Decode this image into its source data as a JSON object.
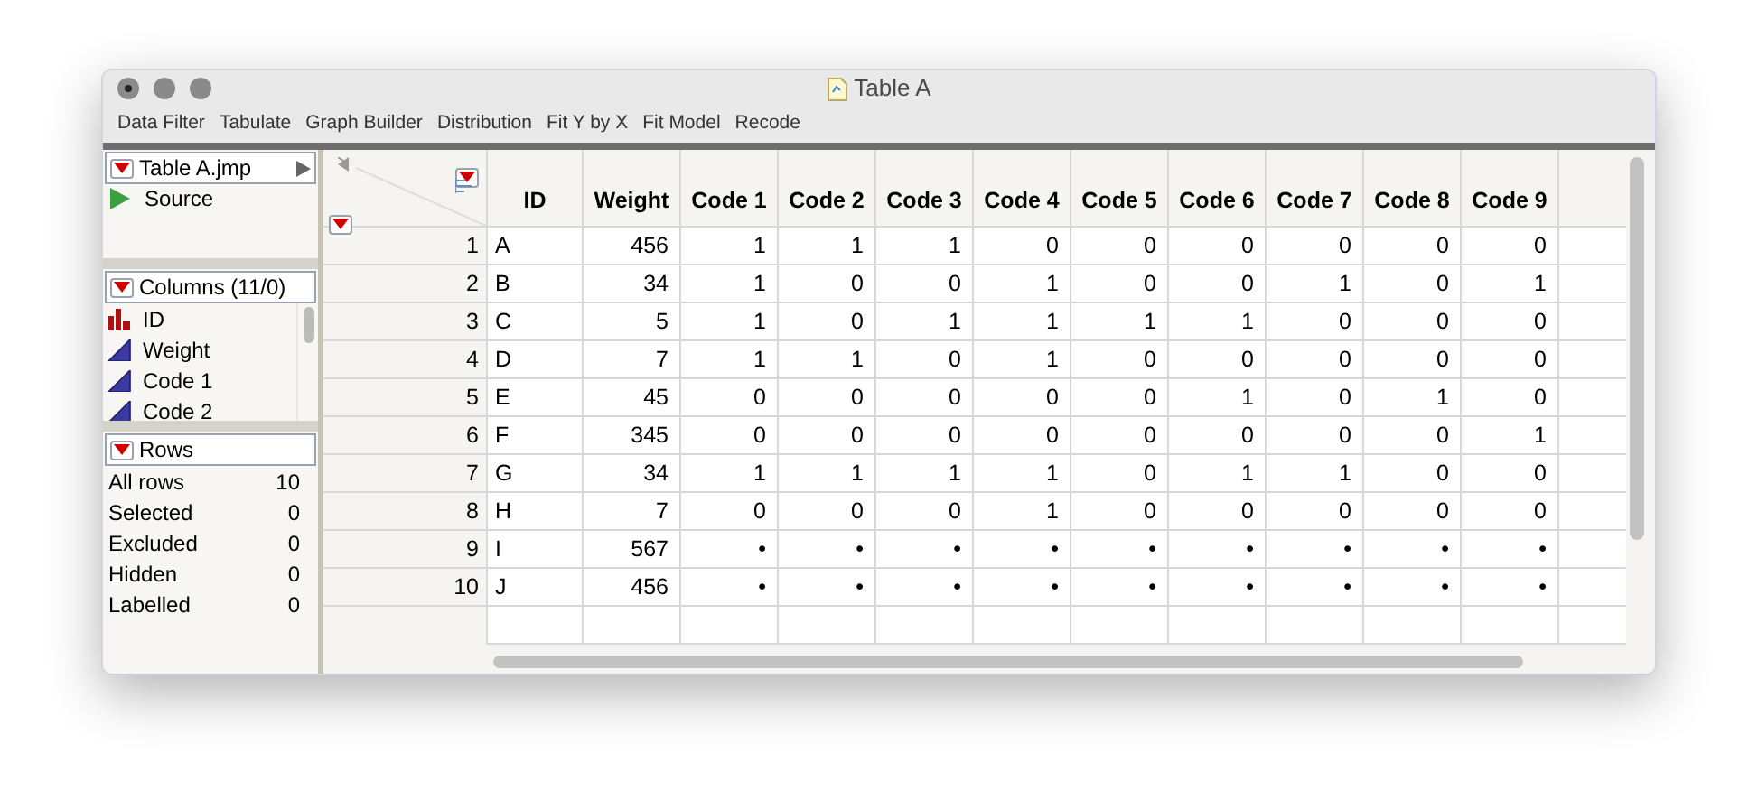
{
  "window": {
    "title": "Table A"
  },
  "toolbar": [
    "Data Filter",
    "Tabulate",
    "Graph Builder",
    "Distribution",
    "Fit Y by X",
    "Fit Model",
    "Recode"
  ],
  "table_panel": {
    "title": "Table A.jmp",
    "items": [
      "Source"
    ]
  },
  "columns_panel": {
    "title": "Columns (11/0)",
    "items": [
      {
        "name": "ID",
        "kind": "nominal"
      },
      {
        "name": "Weight",
        "kind": "continuous"
      },
      {
        "name": "Code 1",
        "kind": "continuous"
      },
      {
        "name": "Code 2",
        "kind": "continuous"
      }
    ]
  },
  "rows_panel": {
    "title": "Rows",
    "items": [
      {
        "label": "All rows",
        "value": "10"
      },
      {
        "label": "Selected",
        "value": "0"
      },
      {
        "label": "Excluded",
        "value": "0"
      },
      {
        "label": "Hidden",
        "value": "0"
      },
      {
        "label": "Labelled",
        "value": "0"
      }
    ]
  },
  "table": {
    "columns": [
      "ID",
      "Weight",
      "Code 1",
      "Code 2",
      "Code 3",
      "Code 4",
      "Code 5",
      "Code 6",
      "Code 7",
      "Code 8",
      "Code 9"
    ],
    "rows": [
      {
        "number": "1",
        "cells": [
          "A",
          "456",
          "1",
          "1",
          "1",
          "0",
          "0",
          "0",
          "0",
          "0",
          "0"
        ]
      },
      {
        "number": "2",
        "cells": [
          "B",
          "34",
          "1",
          "0",
          "0",
          "1",
          "0",
          "0",
          "1",
          "0",
          "1"
        ]
      },
      {
        "number": "3",
        "cells": [
          "C",
          "5",
          "1",
          "0",
          "1",
          "1",
          "1",
          "1",
          "0",
          "0",
          "0"
        ]
      },
      {
        "number": "4",
        "cells": [
          "D",
          "7",
          "1",
          "1",
          "0",
          "1",
          "0",
          "0",
          "0",
          "0",
          "0"
        ]
      },
      {
        "number": "5",
        "cells": [
          "E",
          "45",
          "0",
          "0",
          "0",
          "0",
          "0",
          "1",
          "0",
          "1",
          "0"
        ]
      },
      {
        "number": "6",
        "cells": [
          "F",
          "345",
          "0",
          "0",
          "0",
          "0",
          "0",
          "0",
          "0",
          "0",
          "1"
        ]
      },
      {
        "number": "7",
        "cells": [
          "G",
          "34",
          "1",
          "1",
          "1",
          "1",
          "0",
          "1",
          "1",
          "0",
          "0"
        ]
      },
      {
        "number": "8",
        "cells": [
          "H",
          "7",
          "0",
          "0",
          "0",
          "1",
          "0",
          "0",
          "0",
          "0",
          "0"
        ]
      },
      {
        "number": "9",
        "cells": [
          "I",
          "567",
          "•",
          "•",
          "•",
          "•",
          "•",
          "•",
          "•",
          "•",
          "•"
        ]
      },
      {
        "number": "10",
        "cells": [
          "J",
          "456",
          "•",
          "•",
          "•",
          "•",
          "•",
          "•",
          "•",
          "•",
          "•"
        ]
      }
    ]
  }
}
